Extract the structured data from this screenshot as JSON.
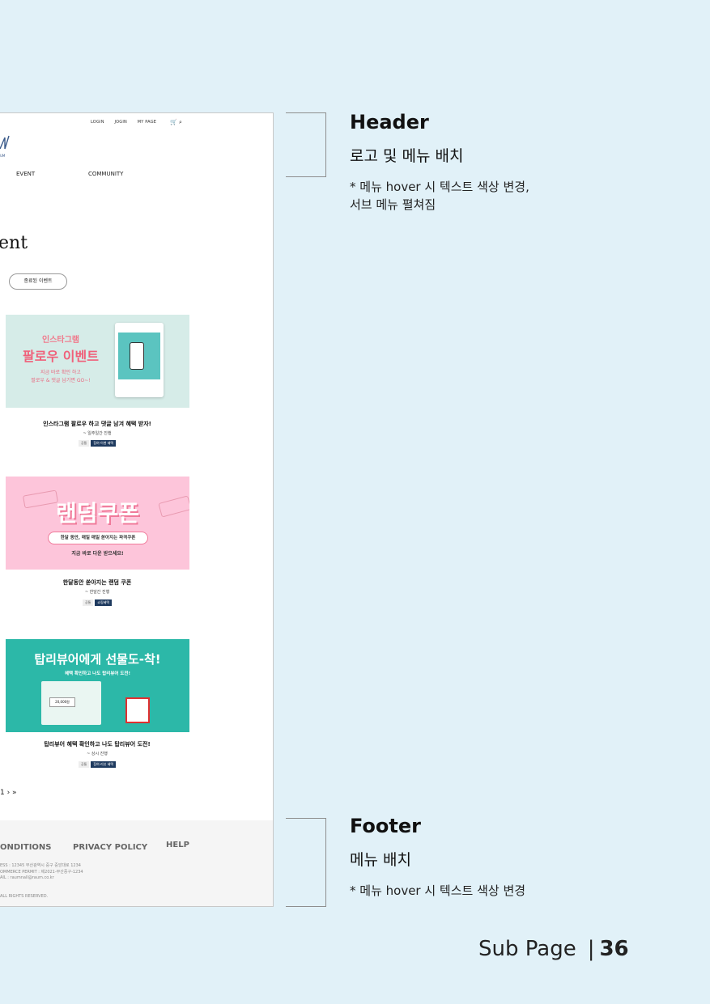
{
  "mock": {
    "top_nav": [
      "LOGIN",
      "JOGIN",
      "MY PAGE"
    ],
    "logo_text": "UM",
    "main_nav": [
      "EVENT",
      "COMMUNITY"
    ],
    "page_title": "ent",
    "ended_button": "종료된 이벤트",
    "events": [
      {
        "banner_lines": [
          "인스타그램",
          "팔로우 이벤트",
          "지금 바로 확인 하고",
          "팔로우 & 댓글 남기면 GO~!"
        ],
        "title": "인스타그램 팔로우 하고 댓글 남겨 혜택 받자!",
        "period": "~ 일주일간 진행",
        "tags": [
          "공통",
          "참여·이벤 혜택"
        ]
      },
      {
        "banner_lines": [
          "랜덤쿠폰",
          "한달 동안, 매일 매일 쏟아지는 파격쿠폰",
          "지금 바로 다운 받으세요!"
        ],
        "title": "한달동안 쏟아지는 랜덤 쿠폰",
        "period": "~ 한달간 진행",
        "tags": [
          "공통",
          "쇼핑혜택"
        ]
      },
      {
        "banner_lines": [
          "탑리뷰어에게 선물도-착!",
          "혜택 확인하고 나도 탑리뷰어 도전!",
          "20,000원"
        ],
        "title": "탑리뷰어 혜택 확인하고 나도 탑리뷰어 도전!",
        "period": "~ 상시 진행",
        "tags": [
          "공통",
          "참여·리뷰 혜택"
        ]
      }
    ],
    "pagination": "1 › »",
    "footer": {
      "links": [
        "ONDITIONS",
        "PRIVACY POLICY",
        "HELP"
      ],
      "info": [
        "ESS : 12345 부산광역시 중구 중앙대로 1234",
        "OMMERCE PERMIT : 제2021-부산중구-1234",
        "AIL : raumnall@raum.co.kr",
        "ALL RIGHTS RESERVED."
      ]
    }
  },
  "annotations": {
    "header": {
      "title": "Header",
      "subtitle": "로고 및 메뉴 배치",
      "note_line1": "* 메뉴 hover 시 텍스트 색상 변경,",
      "note_line2": "서브 메뉴 펼쳐짐"
    },
    "footer": {
      "title": "Footer",
      "subtitle": "메뉴 배치",
      "note_line1": "* 메뉴 hover 시 텍스트 색상 변경"
    }
  },
  "page_label": {
    "section": "Sub Page",
    "number": "36"
  },
  "colors": {
    "background": "#e1f1f8",
    "insta_banner": "#d6ece8",
    "coupon_banner": "#fdc5da",
    "review_banner": "#2cb8a8",
    "tag_dark": "#1e3a5f"
  }
}
